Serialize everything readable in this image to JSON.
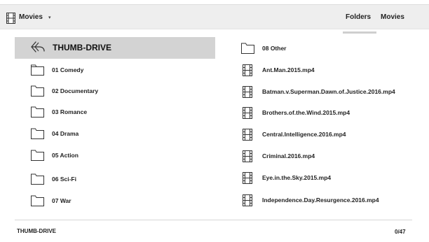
{
  "header": {
    "title": "Movies",
    "caret": "▾",
    "tabs": [
      {
        "label": "Folders",
        "active": true
      },
      {
        "label": "Movies",
        "active": false
      }
    ]
  },
  "location": {
    "current": "THUMB-DRIVE"
  },
  "left_column": [
    {
      "type": "folder",
      "label": "01 Comedy",
      "icon": "folder-icon"
    },
    {
      "type": "folder",
      "label": "02 Documentary",
      "icon": "folder-icon"
    },
    {
      "type": "folder",
      "label": "03 Romance",
      "icon": "folder-icon"
    },
    {
      "type": "folder",
      "label": "04 Drama",
      "icon": "folder-icon"
    },
    {
      "type": "folder",
      "label": "05 Action",
      "icon": "folder-icon"
    },
    {
      "type": "folder",
      "label": "06 Sci-Fi",
      "icon": "folder-icon"
    },
    {
      "type": "folder",
      "label": "07 War",
      "icon": "folder-icon"
    }
  ],
  "right_column": [
    {
      "type": "folder",
      "label": "08 Other",
      "icon": "folder-icon"
    },
    {
      "type": "file",
      "label": "Ant.Man.2015.mp4",
      "icon": "film-icon"
    },
    {
      "type": "file",
      "label": "Batman.v.Superman.Dawn.of.Justice.2016.mp4",
      "icon": "film-icon"
    },
    {
      "type": "file",
      "label": "Brothers.of.the.Wind.2015.mp4",
      "icon": "film-icon"
    },
    {
      "type": "file",
      "label": "Central.Intelligence.2016.mp4",
      "icon": "film-icon"
    },
    {
      "type": "file",
      "label": "Criminal.2016.mp4",
      "icon": "film-icon"
    },
    {
      "type": "file",
      "label": "Eye.in.the.Sky.2015.mp4",
      "icon": "film-icon"
    },
    {
      "type": "file",
      "label": "Independence.Day.Resurgence.2016.mp4",
      "icon": "film-icon"
    }
  ],
  "footer": {
    "path": "THUMB-DRIVE",
    "position": "0/47"
  },
  "colors": {
    "topbar": "#eeeeee",
    "selected_row": "#d3d3d3",
    "tab_underline": "#cfcfcf"
  }
}
